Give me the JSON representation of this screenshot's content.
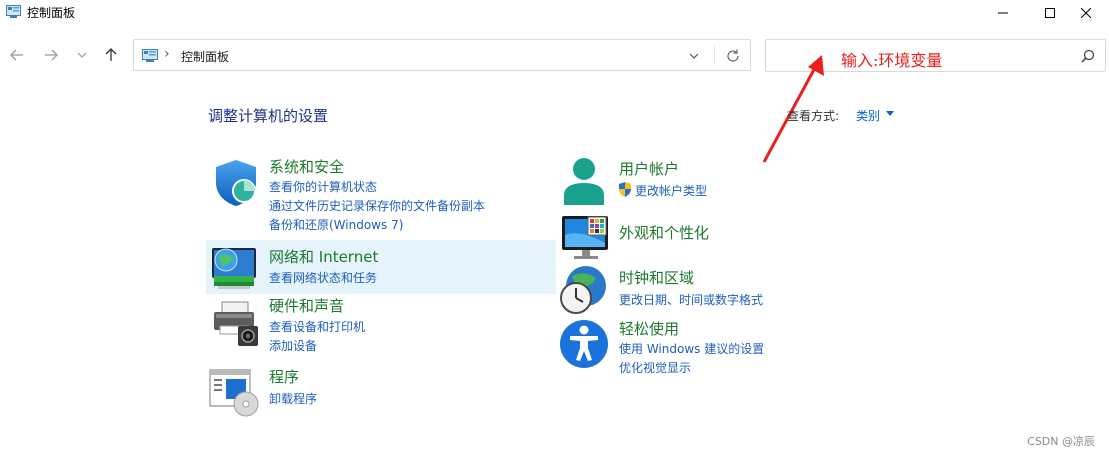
{
  "window": {
    "title": "控制面板"
  },
  "address": {
    "separator": "›",
    "path": "控制面板"
  },
  "search": {
    "placeholder": ""
  },
  "annotation": {
    "text": "输入:环境变量",
    "color": "#e8201e"
  },
  "main": {
    "title": "调整计算机的设置",
    "viewby_label": "查看方式:",
    "viewby_value": "类别"
  },
  "categories": [
    {
      "title": "系统和安全",
      "links": [
        "查看你的计算机状态",
        "通过文件历史记录保存你的文件备份副本",
        "备份和还原(Windows 7)"
      ],
      "icon": "shield-icon"
    },
    {
      "title": "网络和 Internet",
      "links": [
        "查看网络状态和任务"
      ],
      "icon": "network-globe-icon"
    },
    {
      "title": "硬件和声音",
      "links": [
        "查看设备和打印机",
        "添加设备"
      ],
      "icon": "printer-icon"
    },
    {
      "title": "程序",
      "links": [
        "卸载程序"
      ],
      "icon": "programs-icon"
    },
    {
      "title": "用户帐户",
      "links": [
        "更改帐户类型"
      ],
      "icon": "user-icon"
    },
    {
      "title": "外观和个性化",
      "links": [],
      "icon": "monitor-icon"
    },
    {
      "title": "时钟和区域",
      "links": [
        "更改日期、时间或数字格式"
      ],
      "icon": "clock-globe-icon"
    },
    {
      "title": "轻松使用",
      "links": [
        "使用 Windows 建议的设置",
        "优化视觉显示"
      ],
      "icon": "accessibility-icon"
    }
  ],
  "footer": {
    "watermark": "CSDN @凉辰"
  },
  "colors": {
    "category_title": "#1c7a2c",
    "link": "#1d5fbf",
    "heading": "#1e3287",
    "highlight": "#e5f3fb"
  }
}
